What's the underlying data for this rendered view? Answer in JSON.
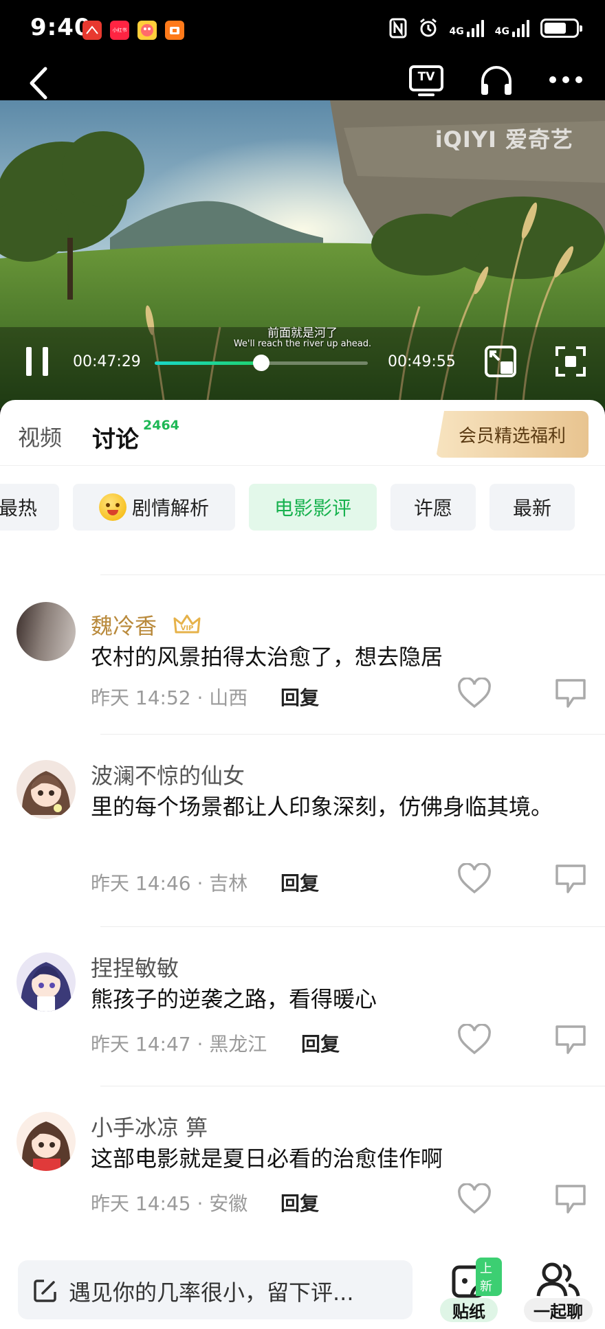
{
  "status_bar": {
    "time": "9:40",
    "app_icons": [
      "huawei-app-icon",
      "xiaohongshu-icon",
      "game-app-icon",
      "orange-app-icon"
    ],
    "xiaohongshu_label": "小红书",
    "network_label_1": "4G",
    "network_label_2": "4G"
  },
  "video": {
    "watermark": "iQIYI 爱奇艺",
    "subtitle_cn": "前面就是河了",
    "subtitle_en": "We'll reach the river up ahead.",
    "current_time": "00:47:29",
    "total_time": "00:49:55",
    "progress_fraction": 0.5,
    "tv_label": "TV"
  },
  "tabs": {
    "video": "视频",
    "discussion": "讨论",
    "discussion_count": "2464",
    "vip_banner": "会员精选福利"
  },
  "chips": [
    {
      "label": "最热",
      "active": false
    },
    {
      "label": "剧情解析",
      "active": false,
      "emoji": true
    },
    {
      "label": "电影影评",
      "active": true
    },
    {
      "label": "许愿",
      "active": false
    },
    {
      "label": "最新",
      "active": false
    }
  ],
  "comments": [
    {
      "user": "魏冷香",
      "vip": true,
      "text": "农村的风景拍得太治愈了，想去隐居",
      "time": "昨天 14:52 · 山西",
      "reply": "回复"
    },
    {
      "user": "波澜不惊的仙女",
      "vip": false,
      "text": "里的每个场景都让人印象深刻，仿佛身临其境。",
      "time": "昨天 14:46 · 吉林",
      "reply": "回复"
    },
    {
      "user": "捏捏敏敏",
      "vip": false,
      "text": "熊孩子的逆袭之路，看得暖心",
      "time": "昨天 14:47 · 黑龙江",
      "reply": "回复"
    },
    {
      "user": "小手冰凉 箅",
      "vip": false,
      "text": "这部电影就是夏日必看的治愈佳作啊",
      "time": "昨天 14:45 · 安徽",
      "reply": "回复"
    }
  ],
  "bottom": {
    "input_placeholder": "遇见你的几率很小，留下评...",
    "sticker_label": "贴纸",
    "new_badge": "上新",
    "together_label": "一起聊"
  },
  "colors": {
    "accent_green": "#18b24f",
    "vip_gold": "#b98a3c",
    "progress_start": "#19d7c8",
    "progress_end": "#20d36f"
  }
}
